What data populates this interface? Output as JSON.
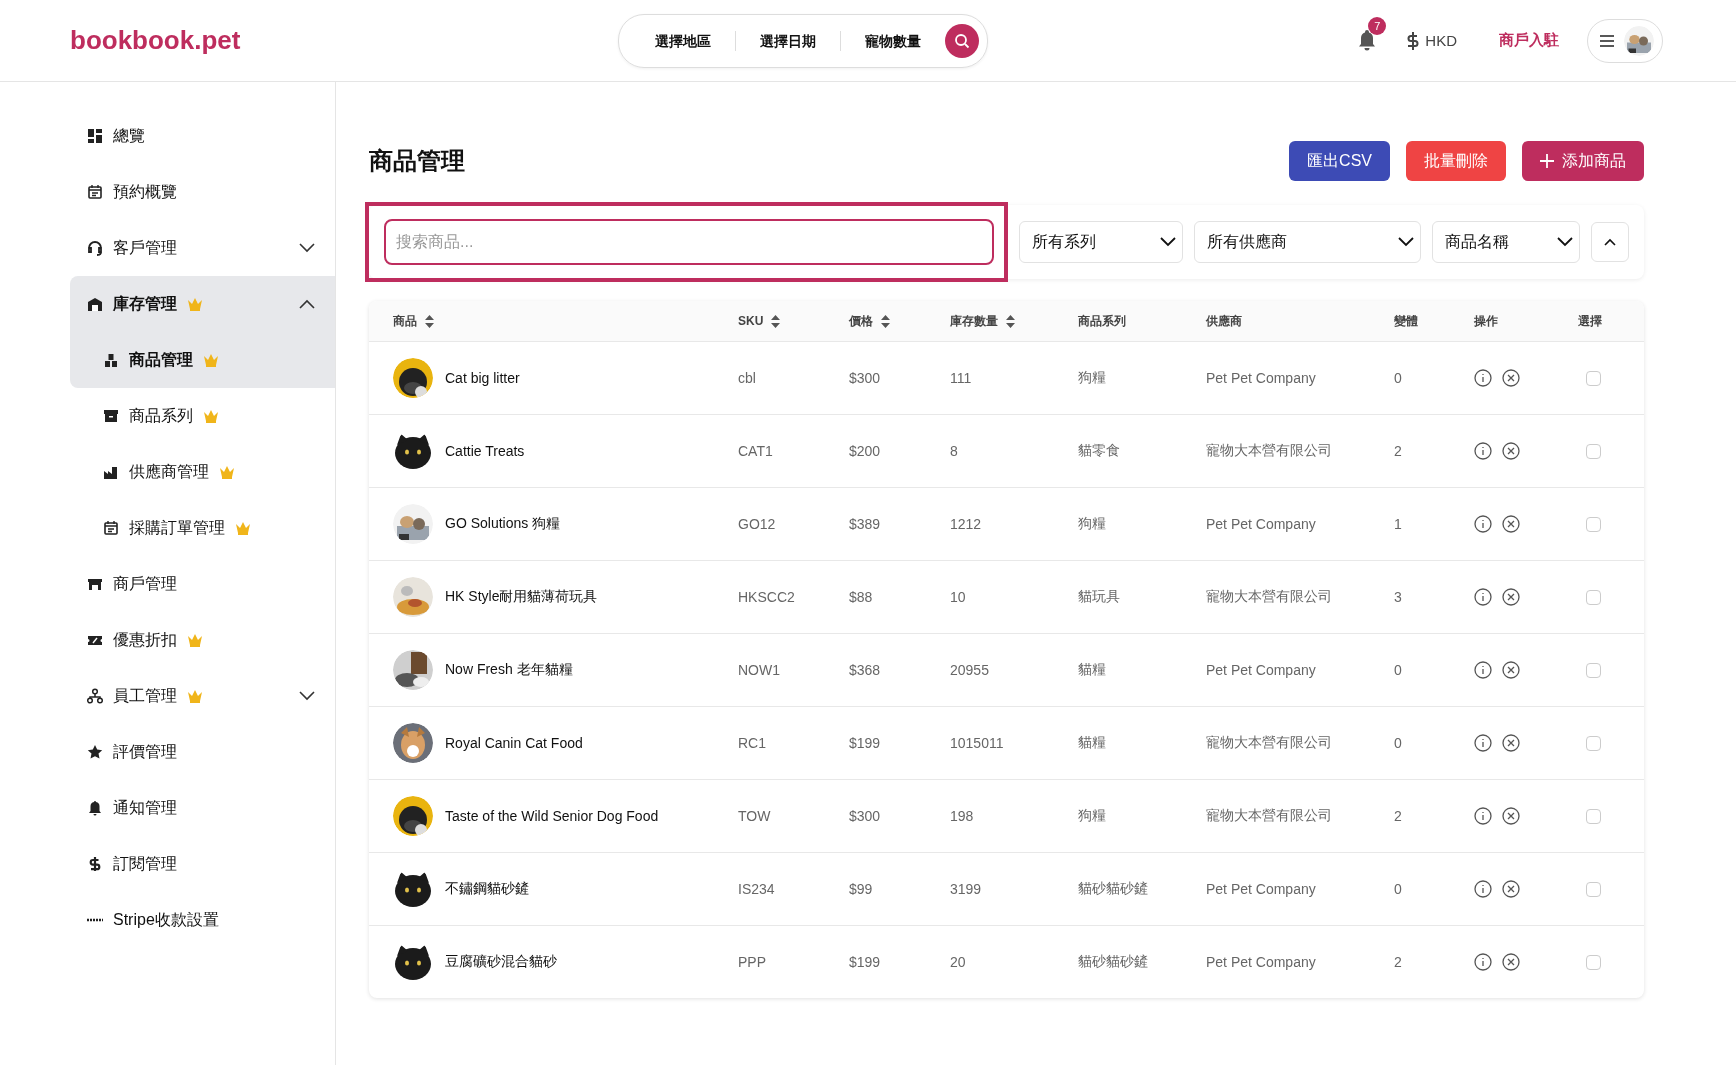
{
  "header": {
    "logo": "bookbook.pet",
    "search_pill": {
      "segments": [
        "選擇地區",
        "選擇日期",
        "寵物數量"
      ]
    },
    "notifications": {
      "count": "7"
    },
    "currency": "HKD",
    "merchant_link": "商戶入駐"
  },
  "sidebar": {
    "items": [
      {
        "label": "總覽",
        "premium": false,
        "selected": false
      },
      {
        "label": "預約概覽",
        "premium": false,
        "selected": false
      },
      {
        "label": "客戶管理",
        "premium": false,
        "selected": false,
        "expanded": false
      },
      {
        "label": "庫存管理",
        "premium": true,
        "selected": true,
        "expanded": true,
        "children": [
          {
            "label": "商品管理",
            "premium": true,
            "selected": true
          },
          {
            "label": "商品系列",
            "premium": true,
            "selected": false
          },
          {
            "label": "供應商管理",
            "premium": true,
            "selected": false
          },
          {
            "label": "採購訂單管理",
            "premium": true,
            "selected": false
          }
        ]
      },
      {
        "label": "商戶管理",
        "premium": false,
        "selected": false
      },
      {
        "label": "優惠折扣",
        "premium": true,
        "selected": false
      },
      {
        "label": "員工管理",
        "premium": true,
        "selected": false,
        "expanded": false
      },
      {
        "label": "評價管理",
        "premium": false,
        "selected": false
      },
      {
        "label": "通知管理",
        "premium": false,
        "selected": false
      },
      {
        "label": "訂閱管理",
        "premium": false,
        "selected": false
      },
      {
        "label": "Stripe收款設置",
        "premium": false,
        "selected": false
      }
    ]
  },
  "page": {
    "title": "商品管理",
    "buttons": [
      {
        "label": "匯出CSV",
        "kind": "export"
      },
      {
        "label": "批量刪除",
        "kind": "danger"
      },
      {
        "label": "添加商品",
        "kind": "add"
      }
    ]
  },
  "filters": {
    "search": {
      "placeholder": "搜索商品...",
      "highlighted": true
    },
    "dropdowns": [
      "所有系列",
      "所有供應商",
      "商品名稱"
    ]
  },
  "table": {
    "columns": [
      {
        "label": "商品",
        "sortable": true
      },
      {
        "label": "SKU",
        "sortable": true
      },
      {
        "label": "價格",
        "sortable": true
      },
      {
        "label": "庫存數量",
        "sortable": true
      },
      {
        "label": "商品系列",
        "sortable": false
      },
      {
        "label": "供應商",
        "sortable": false
      },
      {
        "label": "變體",
        "sortable": false
      },
      {
        "label": "操作",
        "sortable": false
      },
      {
        "label": "選擇",
        "sortable": false
      }
    ],
    "rows": [
      {
        "name": "Cat big litter",
        "sku": "cbl",
        "price": "$300",
        "stock": "111",
        "series": "狗糧",
        "supplier": "Pet Pet Company",
        "variants": "0",
        "selected": false
      },
      {
        "name": "Cattie Treats",
        "sku": "CAT1",
        "price": "$200",
        "stock": "8",
        "series": "貓零食",
        "supplier": "寵物大本營有限公司",
        "variants": "2",
        "selected": false
      },
      {
        "name": "GO Solutions 狗糧",
        "sku": "GO12",
        "price": "$389",
        "stock": "1212",
        "series": "狗糧",
        "supplier": "Pet Pet Company",
        "variants": "1",
        "selected": false
      },
      {
        "name": "HK Style耐用貓薄荷玩具",
        "sku": "HKSCC2",
        "price": "$88",
        "stock": "10",
        "series": "貓玩具",
        "supplier": "寵物大本營有限公司",
        "variants": "3",
        "selected": false
      },
      {
        "name": "Now Fresh 老年貓糧",
        "sku": "NOW1",
        "price": "$368",
        "stock": "20955",
        "series": "貓糧",
        "supplier": "Pet Pet Company",
        "variants": "0",
        "selected": false
      },
      {
        "name": "Royal Canin Cat Food",
        "sku": "RC1",
        "price": "$199",
        "stock": "1015011",
        "series": "貓糧",
        "supplier": "寵物大本營有限公司",
        "variants": "0",
        "selected": false
      },
      {
        "name": "Taste of the Wild Senior Dog Food",
        "sku": "TOW",
        "price": "$300",
        "stock": "198",
        "series": "狗糧",
        "supplier": "寵物大本營有限公司",
        "variants": "2",
        "selected": false
      },
      {
        "name": "不鏽鋼貓砂鏟",
        "sku": "IS234",
        "price": "$99",
        "stock": "3199",
        "series": "貓砂貓砂鏟",
        "supplier": "Pet Pet Company",
        "variants": "0",
        "selected": false
      },
      {
        "name": "豆腐礦砂混合貓砂",
        "sku": "PPP",
        "price": "$199",
        "stock": "20",
        "series": "貓砂貓砂鏟",
        "supplier": "Pet Pet Company",
        "variants": "2",
        "selected": false
      }
    ]
  }
}
